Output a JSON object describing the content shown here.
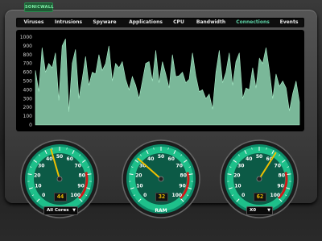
{
  "app": {
    "logo": "SONICWALL"
  },
  "tabs": [
    {
      "label": "Viruses"
    },
    {
      "label": "Intrusions"
    },
    {
      "label": "Spyware"
    },
    {
      "label": "Applications"
    },
    {
      "label": "CPU"
    },
    {
      "label": "Bandwidth"
    },
    {
      "label": "Connections",
      "active": true
    },
    {
      "label": "Events"
    }
  ],
  "colors": {
    "accent": "#5fd4a8",
    "area_fill": "#8fd8b4",
    "gauge_green": "#1ec08a",
    "needle": "#f0c000",
    "redline": "#d01818"
  },
  "chart_data": {
    "type": "area",
    "y_ticks": [
      "1000",
      "900",
      "800",
      "700",
      "600",
      "500",
      "400",
      "300",
      "200",
      "100",
      "0"
    ],
    "ylim": [
      0,
      1000
    ],
    "x": [
      0,
      1,
      2,
      3,
      4,
      5,
      6,
      7,
      8,
      9,
      10,
      11,
      12,
      13,
      14,
      15,
      16,
      17,
      18,
      19,
      20,
      21,
      22,
      23,
      24,
      25,
      26,
      27,
      28,
      29,
      30,
      31,
      32,
      33,
      34,
      35,
      36,
      37,
      38,
      39,
      40,
      41,
      42,
      43,
      44,
      45,
      46,
      47,
      48,
      49,
      50,
      51,
      52,
      53,
      54,
      55,
      56,
      57,
      58,
      59,
      60,
      61,
      62,
      63,
      64,
      65,
      66,
      67,
      68,
      69,
      70,
      71,
      72,
      73,
      74,
      75,
      76,
      77,
      78,
      79
    ],
    "values": [
      620,
      380,
      880,
      600,
      700,
      650,
      820,
      280,
      900,
      980,
      150,
      700,
      860,
      300,
      520,
      780,
      450,
      600,
      580,
      800,
      620,
      700,
      900,
      500,
      700,
      650,
      720,
      520,
      400,
      550,
      450,
      300,
      500,
      700,
      720,
      500,
      850,
      480,
      720,
      580,
      420,
      800,
      550,
      560,
      600,
      480,
      520,
      820,
      560,
      380,
      400,
      300,
      350,
      180,
      600,
      850,
      480,
      600,
      820,
      450,
      720,
      820,
      300,
      420,
      400,
      650,
      420,
      760,
      700,
      880,
      620,
      300,
      580,
      440,
      500,
      420,
      160,
      360,
      500,
      260
    ]
  },
  "gauges": [
    {
      "name": "cpu",
      "value": 44,
      "display": "44",
      "selector": "All Cores"
    },
    {
      "name": "ram",
      "value": 32,
      "display": "32",
      "label": "RAM"
    },
    {
      "name": "x0",
      "value": 62,
      "display": "62",
      "selector": "X0"
    }
  ],
  "gauge_ticks": [
    "0",
    "10",
    "20",
    "30",
    "40",
    "50",
    "60",
    "70",
    "80",
    "90",
    "100"
  ]
}
